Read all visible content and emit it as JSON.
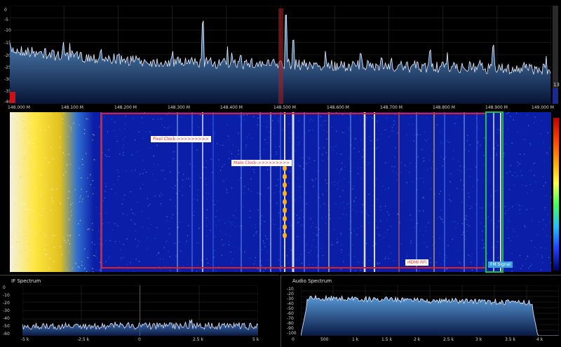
{
  "colors": {
    "background": "#000000",
    "spectrum_fill_top": "#5b9bd5",
    "spectrum_fill_bottom": "#0a1a40",
    "spectrum_line": "#e6eeff",
    "waterfall_base": "#0a1ea8",
    "center_marker": "#cc2020",
    "hdmi_box": "#e02020",
    "fm_box": "#20c040",
    "pixel_label_bg": "#ffffff",
    "pixel_label_fg": "#e03030",
    "main_label_bg": "#ffffff",
    "main_label_fg": "#e03030",
    "hdmi_label_bg": "#ffffff",
    "hdmi_label_fg": "#e03030",
    "fm_label_bg": "#3fa0e0",
    "fm_label_fg": "#ffffff"
  },
  "main_spectrum": {
    "y_ticks": [
      "0",
      "-5",
      "-10",
      "-15",
      "-20",
      "-25",
      "-30",
      "-35",
      "-40"
    ],
    "x_ticks": [
      "148.000 M",
      "148.100 M",
      "148.200 M",
      "148.300 M",
      "148.400 M",
      "148.500 M",
      "148.600 M",
      "148.700 M",
      "148.800 M",
      "148.900 M",
      "149.000 M"
    ],
    "right_value": "13"
  },
  "waterfall": {
    "annotations": {
      "pixel_clock": "Pixel Clock->>>>>>>>>",
      "main_clock": "Main Clock->>>>>>>>>",
      "hdmi_rfi": "HDMI RFI",
      "fm_signal": "FM Signal"
    }
  },
  "if_spectrum": {
    "title": "IF Spectrum",
    "y_ticks": [
      "0",
      "-10",
      "-20",
      "-30",
      "-40",
      "-50",
      "-60"
    ],
    "x_ticks": [
      "-5 k",
      "-2.5 k",
      "0",
      "2.5 k",
      "5 k"
    ]
  },
  "audio_spectrum": {
    "title": "Audio Spectrum",
    "y_ticks": [
      "-10",
      "-20",
      "-30",
      "-40",
      "-50",
      "-60",
      "-70",
      "-80",
      "-90",
      "-100"
    ],
    "x_ticks": [
      "0",
      "500",
      "1 k",
      "1.5 k",
      "2 k",
      "2.5 k",
      "3 k",
      "3.5 k",
      "4 k"
    ]
  }
}
